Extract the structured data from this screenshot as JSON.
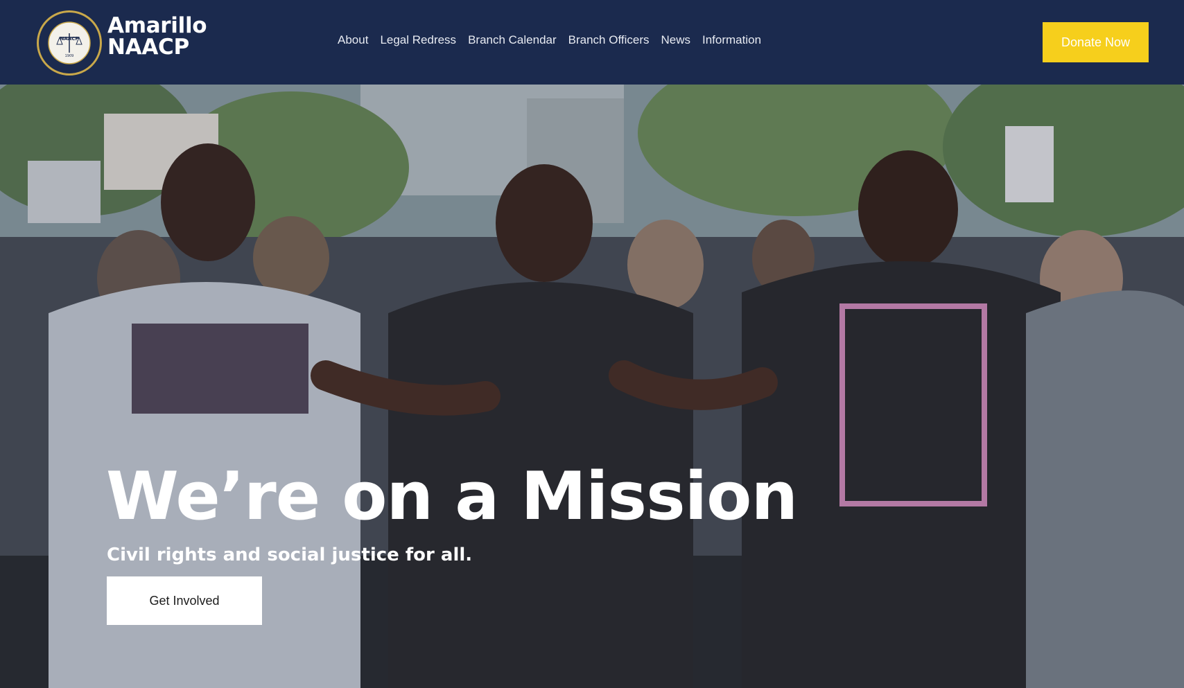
{
  "header": {
    "logo": {
      "line1": "Amarillo",
      "line2": "NAACP",
      "seal_text": "NAACP",
      "seal_year": "1909"
    },
    "nav": [
      {
        "label": "About"
      },
      {
        "label": "Legal Redress"
      },
      {
        "label": "Branch Calendar"
      },
      {
        "label": "Branch Officers"
      },
      {
        "label": "News"
      },
      {
        "label": "Information"
      }
    ],
    "donate_label": "Donate Now"
  },
  "hero": {
    "title": "We’re on a Mission",
    "subtitle": "Civil rights and social justice for all.",
    "cta_label": "Get Involved",
    "photo_icon": "protest-march-photo"
  },
  "colors": {
    "navy": "#1b2a4e",
    "gold": "#f6cf1c",
    "white": "#ffffff"
  }
}
